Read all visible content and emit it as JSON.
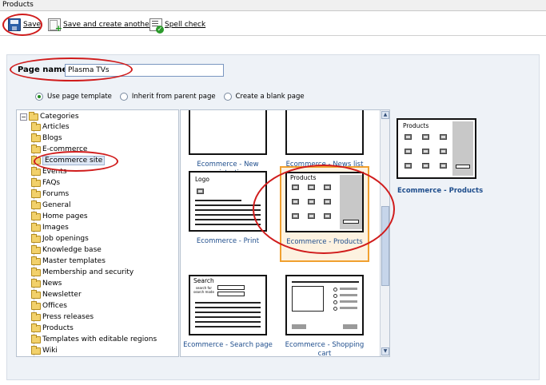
{
  "window": {
    "title": "Products"
  },
  "toolbar": {
    "save_label": "Save",
    "save_another_label": "Save and create another",
    "spell_check_label": "Spell check"
  },
  "form": {
    "page_name_label": "Page name:",
    "page_name_value": "Plasma TVs"
  },
  "options": [
    {
      "label": "Use page template",
      "selected": true
    },
    {
      "label": "Inherit from parent page",
      "selected": false
    },
    {
      "label": "Create a blank page",
      "selected": false
    }
  ],
  "tree": {
    "root": "Categories",
    "items": [
      "Articles",
      "Blogs",
      "E-commerce",
      "Ecommerce site",
      "Events",
      "FAQs",
      "Forums",
      "General",
      "Home pages",
      "Images",
      "Job openings",
      "Knowledge base",
      "Master templates",
      "Membership and security",
      "News",
      "Newsletter",
      "Offices",
      "Press releases",
      "Products",
      "Templates with editable regions",
      "Wiki"
    ],
    "selected": "Ecommerce site"
  },
  "templates": [
    {
      "name": "Ecommerce - New\nregistration",
      "thumb_title": ""
    },
    {
      "name": "Ecommerce - News list",
      "thumb_title": ""
    },
    {
      "name": "Ecommerce - Print",
      "thumb_title": "Logo"
    },
    {
      "name": "Ecommerce - Products",
      "thumb_title": "Products",
      "selected": true
    },
    {
      "name": "Ecommerce - Search page",
      "thumb_title": "Search",
      "thumb_sub": "search for\nsearch mode"
    },
    {
      "name": "Ecommerce - Shopping cart",
      "thumb_title": ""
    }
  ],
  "preview": {
    "title": "Products",
    "caption": "Ecommerce - Products"
  },
  "colors": {
    "annotation": "#d01c1c",
    "selected_border": "#f0a030",
    "link": "#1e4d8c"
  }
}
